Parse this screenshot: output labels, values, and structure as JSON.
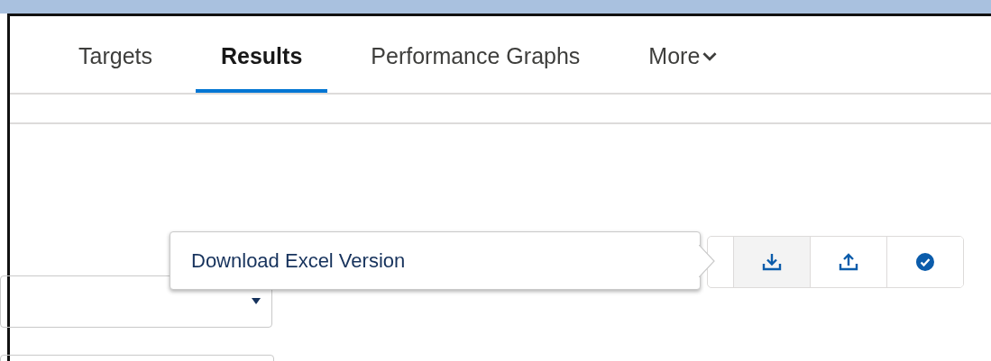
{
  "tabs": [
    {
      "label": "Targets",
      "selected": false
    },
    {
      "label": "Results",
      "selected": true
    },
    {
      "label": "Performance Graphs",
      "selected": false
    },
    {
      "label": "More",
      "selected": false,
      "kind": "menu"
    }
  ],
  "toolbar": {
    "buttons": [
      {
        "kind": "download",
        "selected": true
      },
      {
        "kind": "upload",
        "selected": false
      },
      {
        "kind": "check",
        "selected": false
      }
    ]
  },
  "tooltip": {
    "text": "Download Excel Version"
  }
}
